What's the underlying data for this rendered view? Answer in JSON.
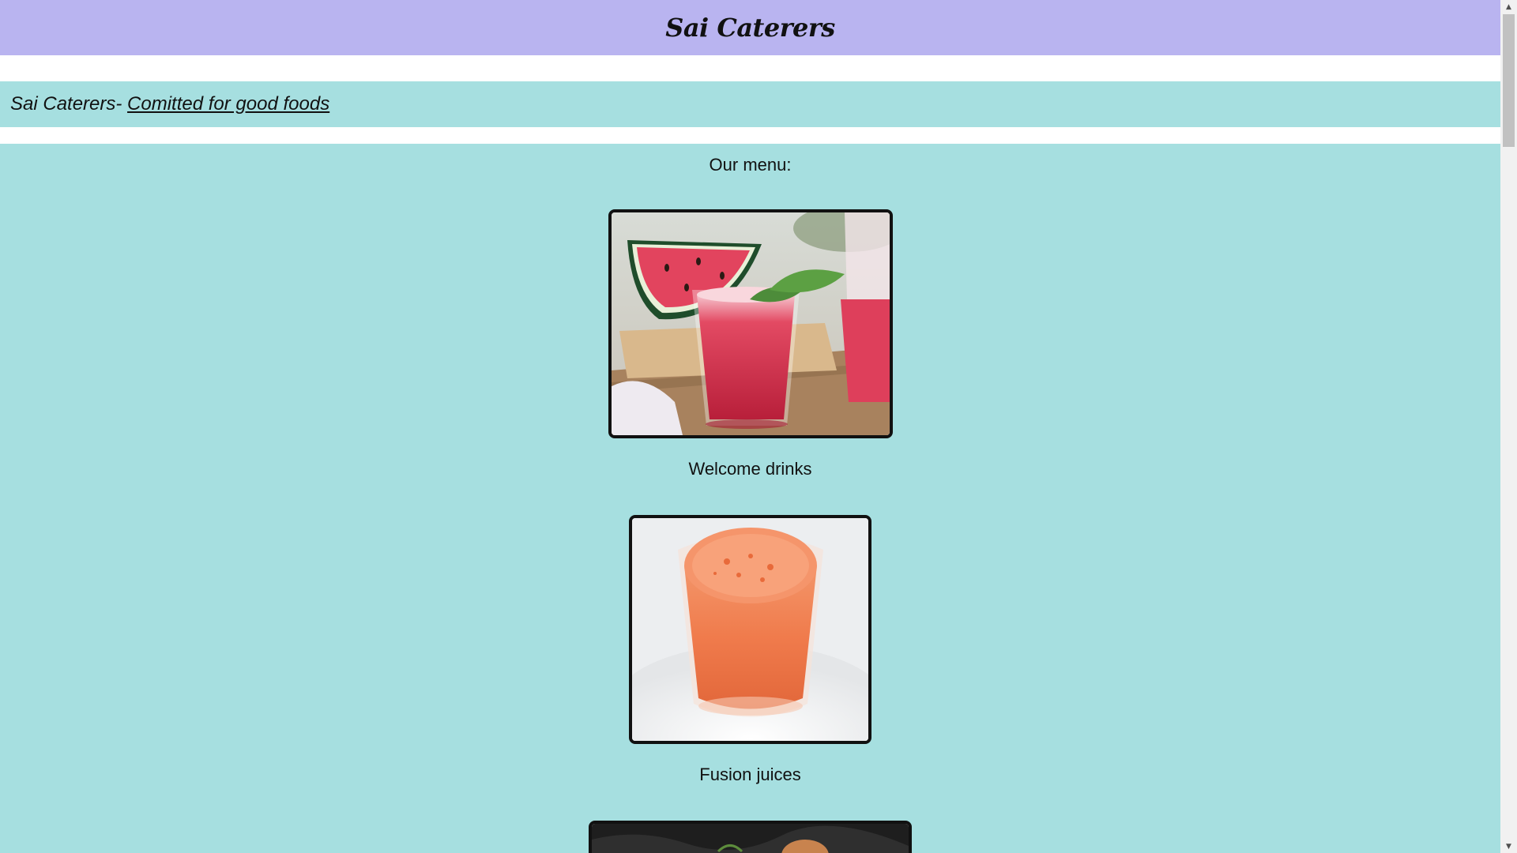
{
  "header": {
    "title": "Sai Caterers"
  },
  "tagline": {
    "prefix": "Sai Caterers- ",
    "link_text": "Comitted for good foods"
  },
  "menu": {
    "heading": "Our menu:",
    "items": [
      {
        "caption": "Welcome drinks",
        "image": "watermelon-juice-image"
      },
      {
        "caption": "Fusion juices",
        "image": "carrot-juice-image"
      },
      {
        "caption": "",
        "image": "dark-food-image"
      }
    ]
  },
  "scrollbar": {
    "up_arrow": "▲",
    "down_arrow": "▼"
  },
  "colors": {
    "header_bg": "#b9b4f0",
    "section_bg": "#a6dfe0",
    "frame_border": "#111111"
  }
}
